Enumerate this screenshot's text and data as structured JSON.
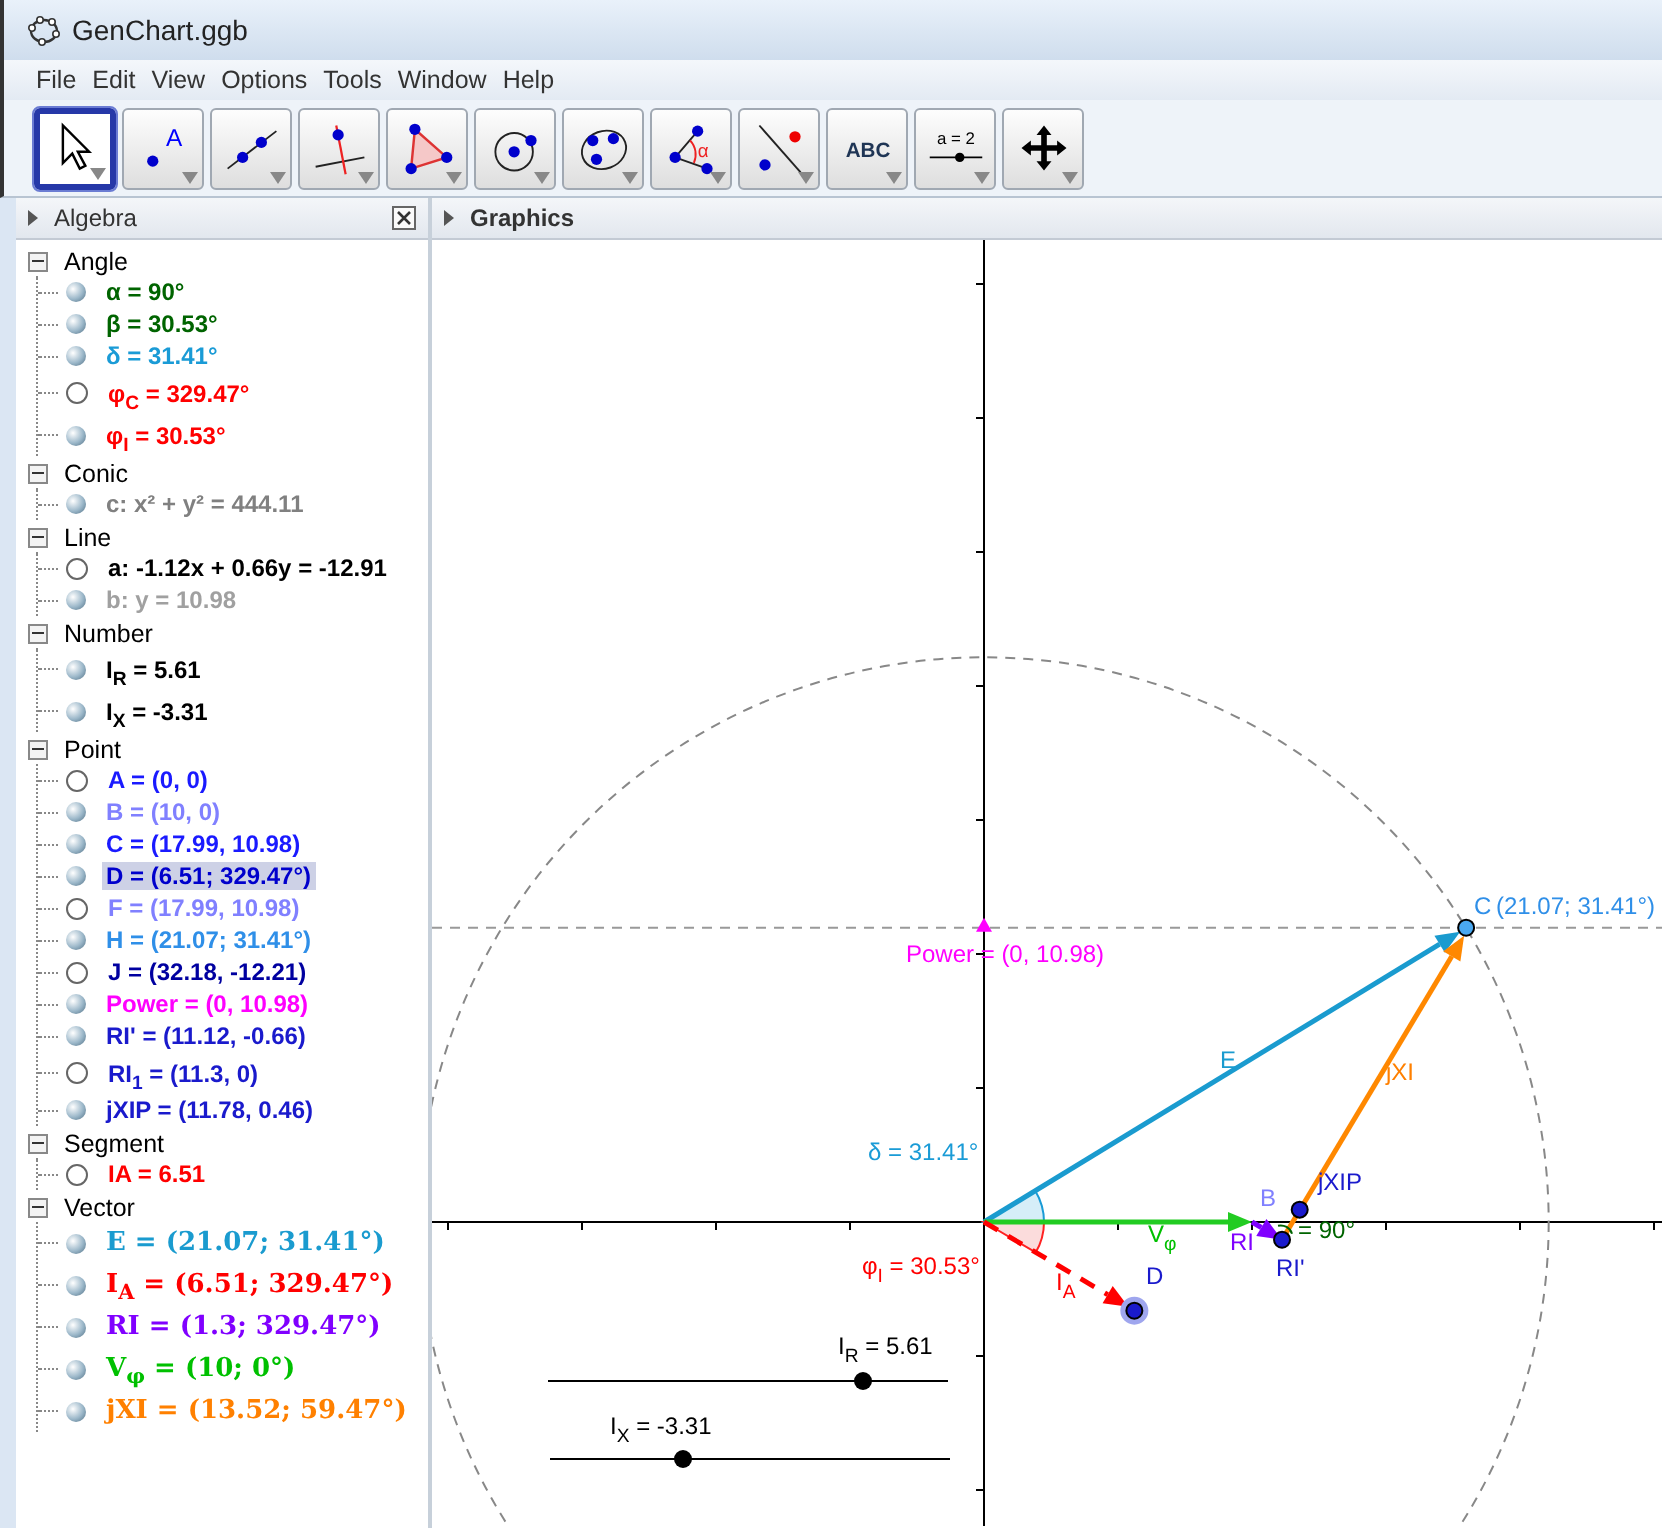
{
  "window": {
    "title": "GenChart.ggb"
  },
  "menu": [
    "File",
    "Edit",
    "View",
    "Options",
    "Tools",
    "Window",
    "Help"
  ],
  "toolbar": [
    {
      "kind": "move",
      "selected": true
    },
    {
      "kind": "point",
      "label": "A",
      "selected": false
    },
    {
      "kind": "line",
      "selected": false
    },
    {
      "kind": "perpendicular",
      "selected": false
    },
    {
      "kind": "polygon",
      "selected": false
    },
    {
      "kind": "circle",
      "selected": false
    },
    {
      "kind": "conic",
      "selected": false
    },
    {
      "kind": "angle",
      "label": "α",
      "selected": false
    },
    {
      "kind": "reflect",
      "selected": false
    },
    {
      "kind": "text",
      "label": "ABC",
      "selected": false
    },
    {
      "kind": "slider",
      "label": "a = 2",
      "selected": false
    },
    {
      "kind": "pan",
      "selected": false
    }
  ],
  "algebra": {
    "title": "Algebra",
    "groups": [
      {
        "name": "Angle",
        "kind": "plain",
        "expanded": true,
        "items": [
          {
            "text": "α = 90°",
            "color": "#006400",
            "visible": true,
            "selected": false
          },
          {
            "text": "β = 30.53°",
            "color": "#006400",
            "visible": true,
            "selected": false
          },
          {
            "text": "δ = 31.41°",
            "color": "#1a9bd6",
            "visible": true,
            "selected": false
          },
          {
            "text": "φ$_{C}$ = 329.47°",
            "color": "#ff0000",
            "visible": false,
            "selected": false
          },
          {
            "text": "φ$_{I}$ = 30.53°",
            "color": "#ff0000",
            "visible": true,
            "selected": false
          }
        ]
      },
      {
        "name": "Conic",
        "kind": "plain",
        "expanded": true,
        "items": [
          {
            "text": "c: x² + y² = 444.11",
            "color": "#808080",
            "visible": true,
            "selected": false
          }
        ]
      },
      {
        "name": "Line",
        "kind": "plain",
        "expanded": true,
        "items": [
          {
            "text": "a: -1.12x + 0.66y = -12.91",
            "color": "#000000",
            "visible": false,
            "selected": false
          },
          {
            "text": "b: y = 10.98",
            "color": "#a0a0a0",
            "visible": true,
            "selected": false
          }
        ]
      },
      {
        "name": "Number",
        "kind": "plain",
        "expanded": true,
        "items": [
          {
            "text": "I$_{R}$ = 5.61",
            "color": "#000000",
            "visible": true,
            "selected": false
          },
          {
            "text": "I$_{X}$ = -3.31",
            "color": "#000000",
            "visible": true,
            "selected": false
          }
        ]
      },
      {
        "name": "Point",
        "kind": "plain",
        "expanded": true,
        "items": [
          {
            "text": "A = (0, 0)",
            "color": "#1a1aff",
            "visible": false,
            "selected": false
          },
          {
            "text": "B = (10, 0)",
            "color": "#8080ff",
            "visible": true,
            "selected": false
          },
          {
            "text": "C = (17.99, 10.98)",
            "color": "#1a1aff",
            "visible": true,
            "selected": false
          },
          {
            "text": "D = (6.51; 329.47°)",
            "color": "#0000cc",
            "visible": true,
            "selected": true
          },
          {
            "text": "F = (17.99, 10.98)",
            "color": "#8080ff",
            "visible": false,
            "selected": false
          },
          {
            "text": "H = (21.07; 31.41°)",
            "color": "#2f8fe8",
            "visible": true,
            "selected": false
          },
          {
            "text": "J = (32.18, -12.21)",
            "color": "#0000a0",
            "visible": false,
            "selected": false
          },
          {
            "text": "Power = (0, 10.98)",
            "color": "#ff00ff",
            "visible": true,
            "selected": false
          },
          {
            "text": "RI' = (11.12, -0.66)",
            "color": "#1a1acc",
            "visible": true,
            "selected": false
          },
          {
            "text": "RI$_{1}$ = (11.3, 0)",
            "color": "#1a1acc",
            "visible": false,
            "selected": false
          },
          {
            "text": "jXIP = (11.78, 0.46)",
            "color": "#1a1acc",
            "visible": true,
            "selected": false
          }
        ]
      },
      {
        "name": "Segment",
        "kind": "plain",
        "expanded": true,
        "items": [
          {
            "text": "IA = 6.51",
            "color": "#ff0000",
            "visible": false,
            "selected": false
          }
        ]
      },
      {
        "name": "Vector",
        "kind": "formula",
        "expanded": true,
        "items": [
          {
            "text": "E = (21.07; 31.41°)",
            "color": "#1a9bcf",
            "visible": true,
            "selected": false
          },
          {
            "text": "I$_{A}$ = (6.51; 329.47°)",
            "color": "#ff0000",
            "visible": true,
            "selected": false
          },
          {
            "text": "RI = (1.3; 329.47°)",
            "color": "#8000ff",
            "visible": true,
            "selected": false
          },
          {
            "text": "V$_{φ}$ = (10; 0°)",
            "color": "#00c000",
            "visible": true,
            "selected": false
          },
          {
            "text": "jXI = (13.52; 59.47°)",
            "color": "#ff8000",
            "visible": true,
            "selected": false
          }
        ]
      }
    ]
  },
  "graphics": {
    "title": "Graphics",
    "labels": [
      {
        "text": "C",
        "color": "#2f8fe8"
      },
      {
        "text": "(21.07; 31.41°)",
        "color": "#2f8fe8"
      },
      {
        "text": "Power = (0, 10.98)",
        "color": "#ff00ff"
      },
      {
        "text": "E",
        "color": "#1a9bcf"
      },
      {
        "text": "jXI",
        "color": "#ff8000"
      },
      {
        "text": "δ = 31.41°",
        "color": "#1a9bd6"
      },
      {
        "text": "jXIP",
        "color": "#1a1acc"
      },
      {
        "text": "B",
        "color": "#8080ff"
      },
      {
        "text": "V$_{φ}$",
        "color": "#00c000"
      },
      {
        "text": "RI",
        "color": "#8000ff"
      },
      {
        "text": "= 90°",
        "color": "#006400"
      },
      {
        "text": "φ$_{I}$ = 30.53°",
        "color": "#ff0000"
      },
      {
        "text": "I$_{A}$",
        "color": "#ff0000"
      },
      {
        "text": "D",
        "color": "#1a1acc"
      },
      {
        "text": "RI'",
        "color": "#1a1acc"
      }
    ],
    "sliders": [
      {
        "label": "I$_{R}$ = 5.61",
        "level": 0.785
      },
      {
        "label": "I$_{X}$ = -3.31",
        "level": 0.33
      }
    ]
  }
}
